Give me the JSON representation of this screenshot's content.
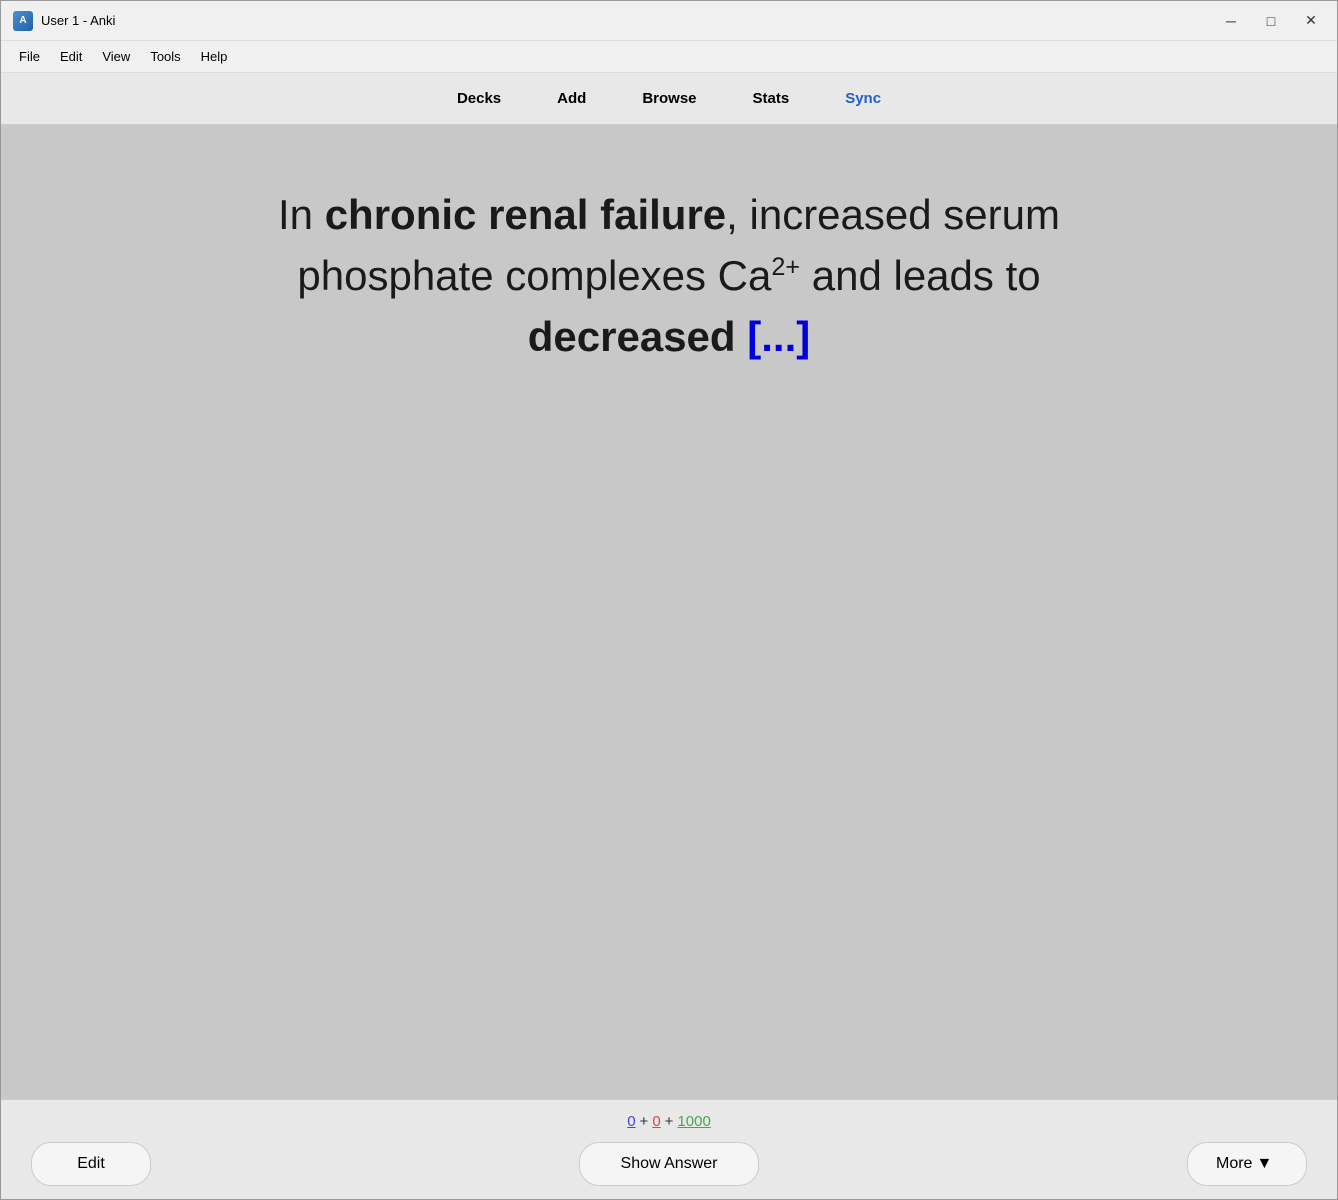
{
  "window": {
    "title": "User 1 - Anki",
    "icon": "A"
  },
  "titlebar": {
    "minimize_label": "─",
    "maximize_label": "□",
    "close_label": "✕"
  },
  "menubar": {
    "items": [
      {
        "label": "File"
      },
      {
        "label": "Edit"
      },
      {
        "label": "View"
      },
      {
        "label": "Tools"
      },
      {
        "label": "Help"
      }
    ]
  },
  "navbar": {
    "tabs": [
      {
        "label": "Decks",
        "active": false
      },
      {
        "label": "Add",
        "active": false
      },
      {
        "label": "Browse",
        "active": false
      },
      {
        "label": "Stats",
        "active": false
      },
      {
        "label": "Sync",
        "active": true
      }
    ]
  },
  "card": {
    "text_before": "In ",
    "text_bold": "chronic renal failure",
    "text_middle": ", increased serum phosphate complexes Ca",
    "superscript": "2+",
    "text_after": " and leads to ",
    "text_bold2": "decreased ",
    "cloze": "[...]"
  },
  "stats": {
    "new_count": "0",
    "learn_count": "0",
    "review_count": "1000",
    "sep1": "+",
    "sep2": "+"
  },
  "buttons": {
    "edit_label": "Edit",
    "show_answer_label": "Show Answer",
    "more_label": "More",
    "more_icon": "▼"
  },
  "colors": {
    "accent_blue": "#2060d0",
    "stat_new": "#4444dd",
    "stat_learn": "#dd4444",
    "stat_review": "#44aa44",
    "cloze": "#0000dd"
  }
}
